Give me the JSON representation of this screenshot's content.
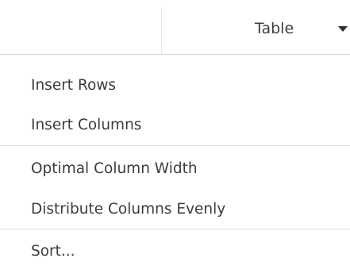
{
  "toolbar": {
    "table_menu": {
      "label": "Table",
      "icon": "chevron-down-icon"
    }
  },
  "menu": {
    "items": [
      {
        "label": "Insert Rows"
      },
      {
        "label": "Insert Columns"
      },
      {
        "label": "Optimal Column Width"
      },
      {
        "label": "Distribute Columns Evenly"
      },
      {
        "label": "Sort..."
      }
    ]
  }
}
